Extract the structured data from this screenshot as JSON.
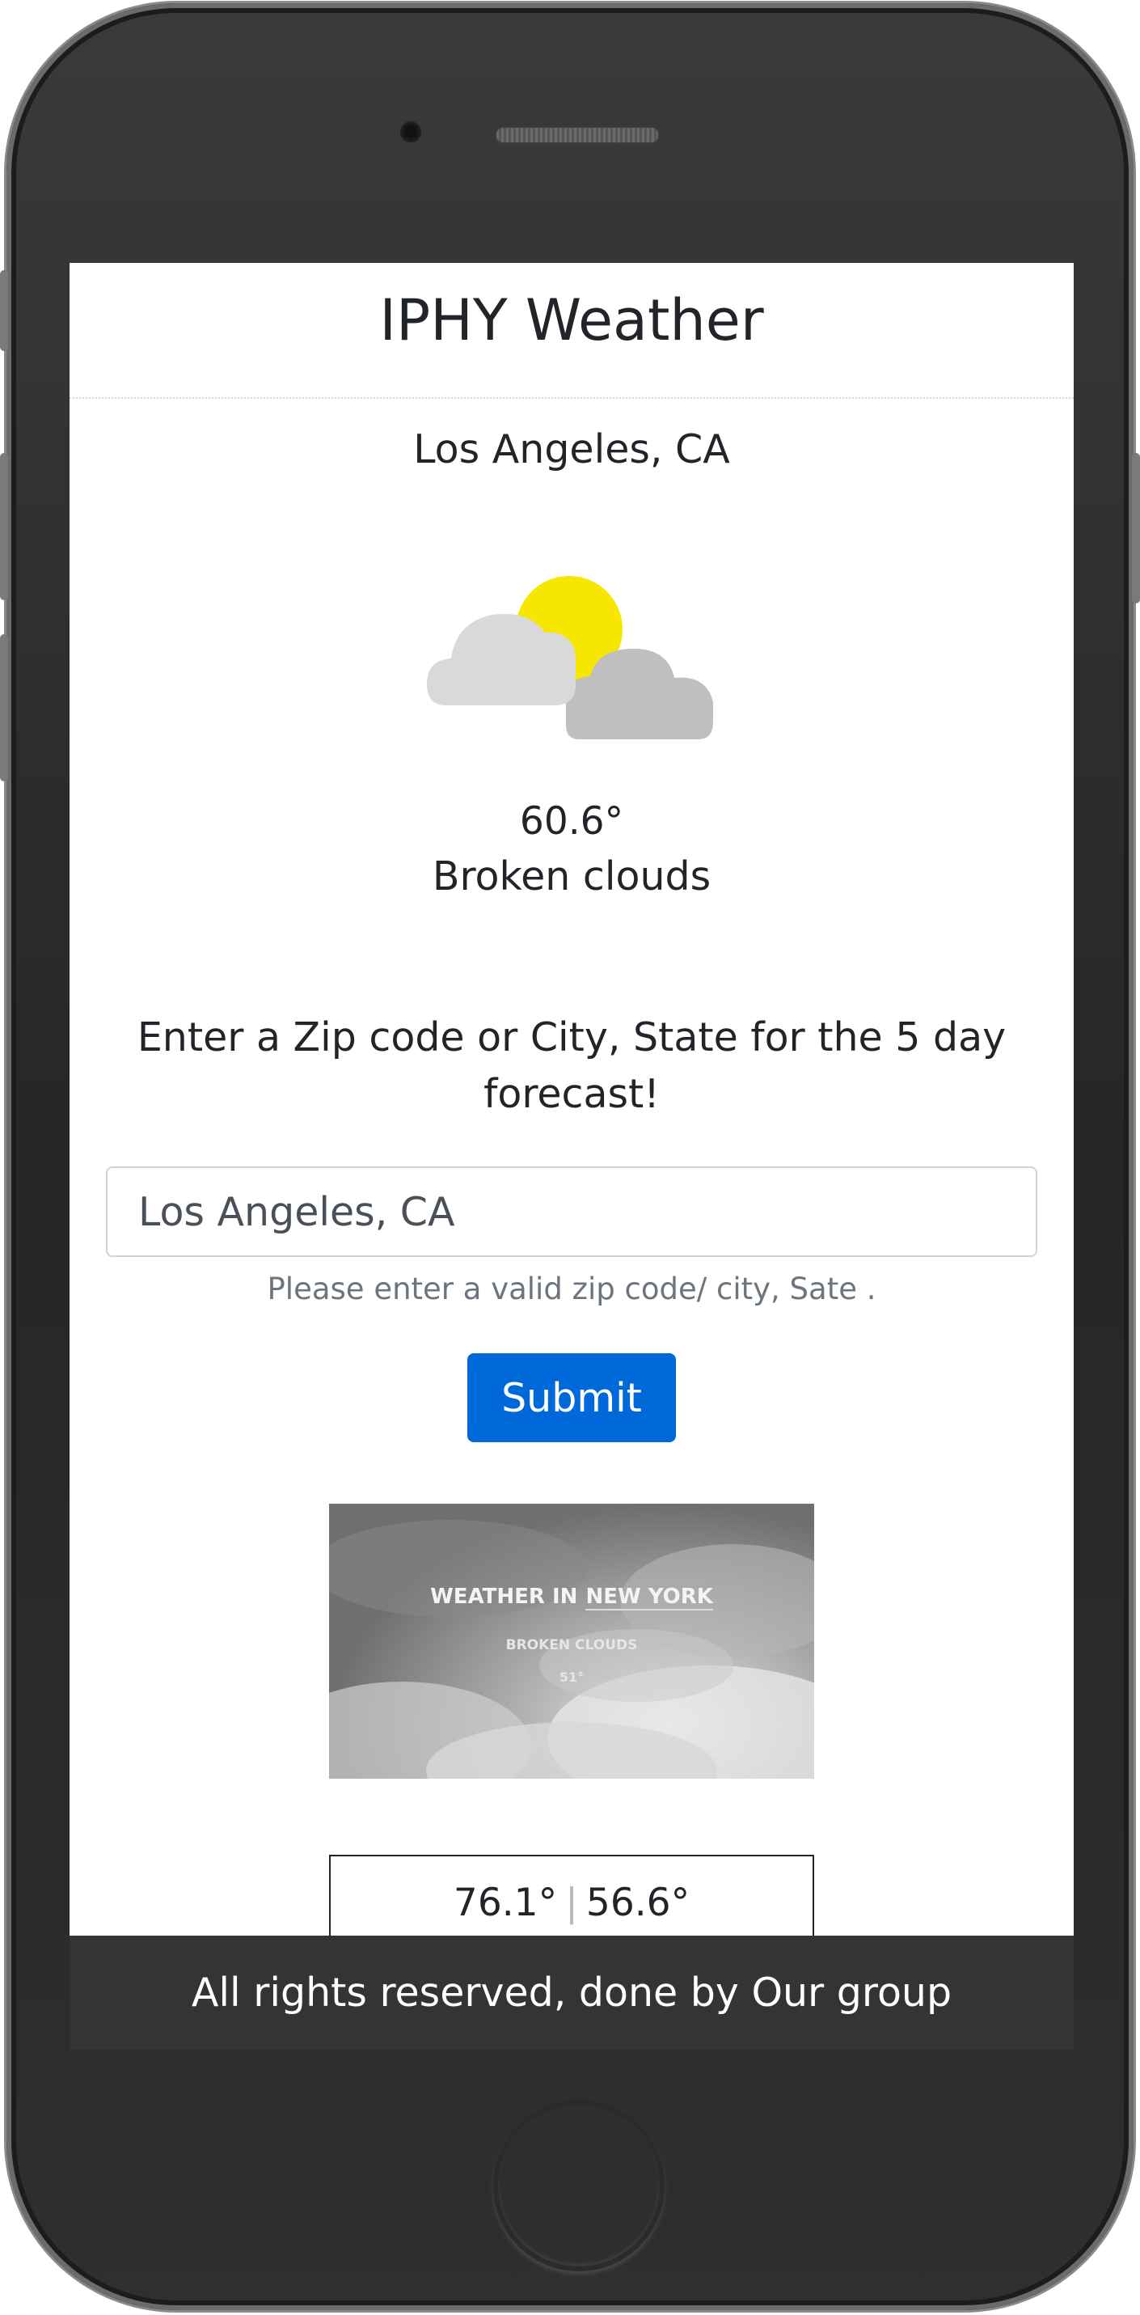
{
  "header": {
    "title": "IPHY Weather"
  },
  "current": {
    "city": "Los Angeles, CA",
    "icon": "broken-clouds-icon",
    "temperature": "60.6°",
    "description": "Broken clouds"
  },
  "search": {
    "prompt": "Enter a Zip code or City, State for the 5 day forecast!",
    "value": "Los Angeles, CA",
    "help_text": "Please enter a valid zip code/ city, Sate .",
    "submit_label": "Submit"
  },
  "gif": {
    "title_prefix": "WEATHER IN",
    "title_location": "NEW YORK",
    "subtitle": "BROKEN CLOUDS",
    "degrees": "51°"
  },
  "forecast": {
    "high": "76.1°",
    "low": "56.6°"
  },
  "footer": {
    "text": "All rights reserved, done by Our group"
  },
  "colors": {
    "primary": "#0069d9",
    "footer_bg": "#343434",
    "sun": "#f7e600",
    "cloud_front": "#d9d9d9",
    "cloud_back": "#bfbfbf"
  }
}
